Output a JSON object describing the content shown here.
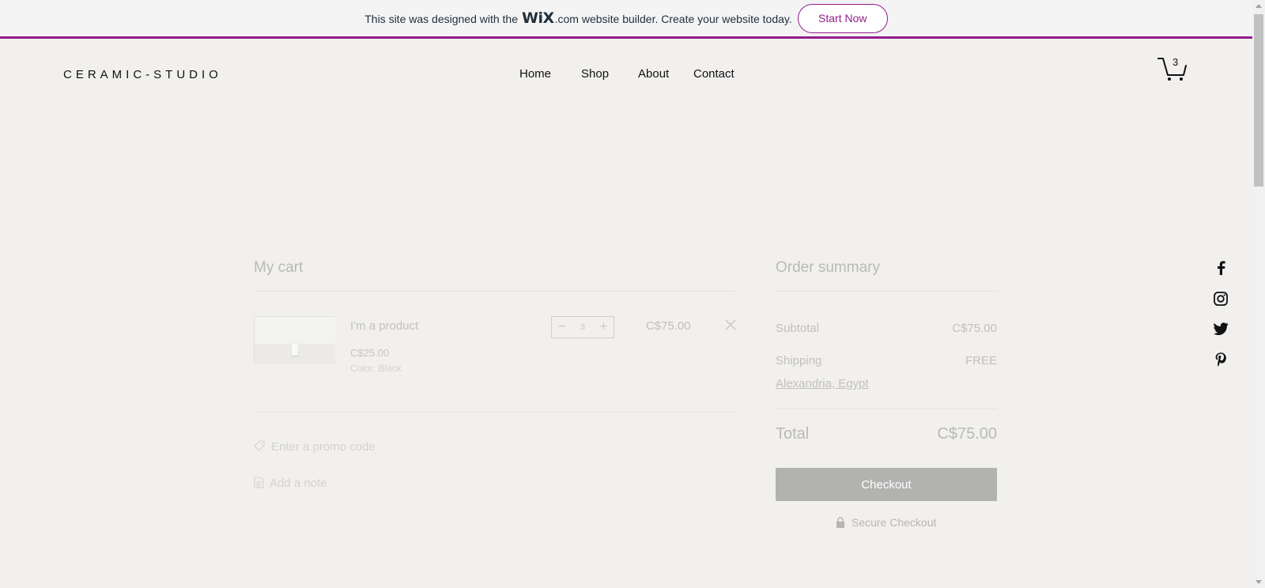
{
  "banner": {
    "pre_text": "This site was designed with the",
    "logo_text": "WiX",
    "post_text": ".com website builder. Create your website today.",
    "button_label": "Start Now"
  },
  "header": {
    "brand": "CERAMIC-STUDIO",
    "nav": [
      "Home",
      "Shop",
      "About",
      "Contact"
    ],
    "cart_count": "3"
  },
  "cart": {
    "title": "My cart",
    "item": {
      "name": "I'm a product",
      "unit_price": "C$25.00",
      "option": "Color: Black",
      "quantity": "3",
      "line_total": "C$75.00"
    },
    "promo_label": "Enter a promo code",
    "note_label": "Add a note"
  },
  "summary": {
    "title": "Order summary",
    "subtotal_label": "Subtotal",
    "subtotal_value": "C$75.00",
    "shipping_label": "Shipping",
    "shipping_value": "FREE",
    "shipping_location": "Alexandria, Egypt",
    "total_label": "Total",
    "total_value": "C$75.00",
    "checkout_label": "Checkout",
    "secure_label": "Secure Checkout"
  },
  "social": [
    "facebook-icon",
    "instagram-icon",
    "twitter-icon",
    "pinterest-icon"
  ],
  "colors": {
    "wix_accent": "#931d8c",
    "checkout_button": "#b2b2b0",
    "page_bg": "#f1f0ee"
  }
}
